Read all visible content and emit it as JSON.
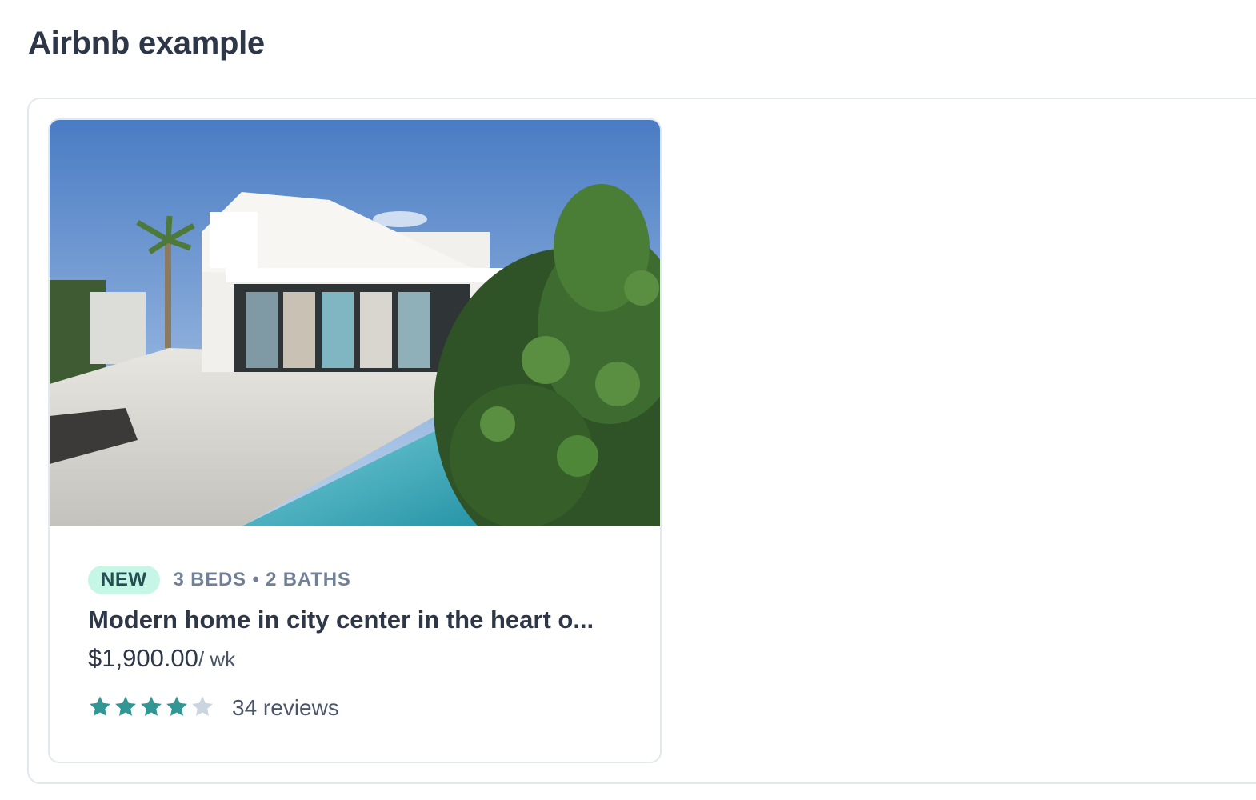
{
  "page": {
    "title": "Airbnb example"
  },
  "listing": {
    "photo_icon": "house-with-pool-photo",
    "badge": "NEW",
    "beds": "3",
    "beds_label": "BEDS",
    "baths": "2",
    "baths_label": "BATHS",
    "meta": "3 BEDS • 2 BATHS",
    "title": "Modern home in city center in the heart o...",
    "price": "$1,900.00",
    "price_unit": "/ wk",
    "rating": 4,
    "rating_max": 5,
    "reviews": "34 reviews"
  },
  "colors": {
    "star_filled": "#319795",
    "star_empty": "#cbd5e0",
    "badge_bg": "#c6f6e5",
    "badge_text": "#234e52"
  }
}
